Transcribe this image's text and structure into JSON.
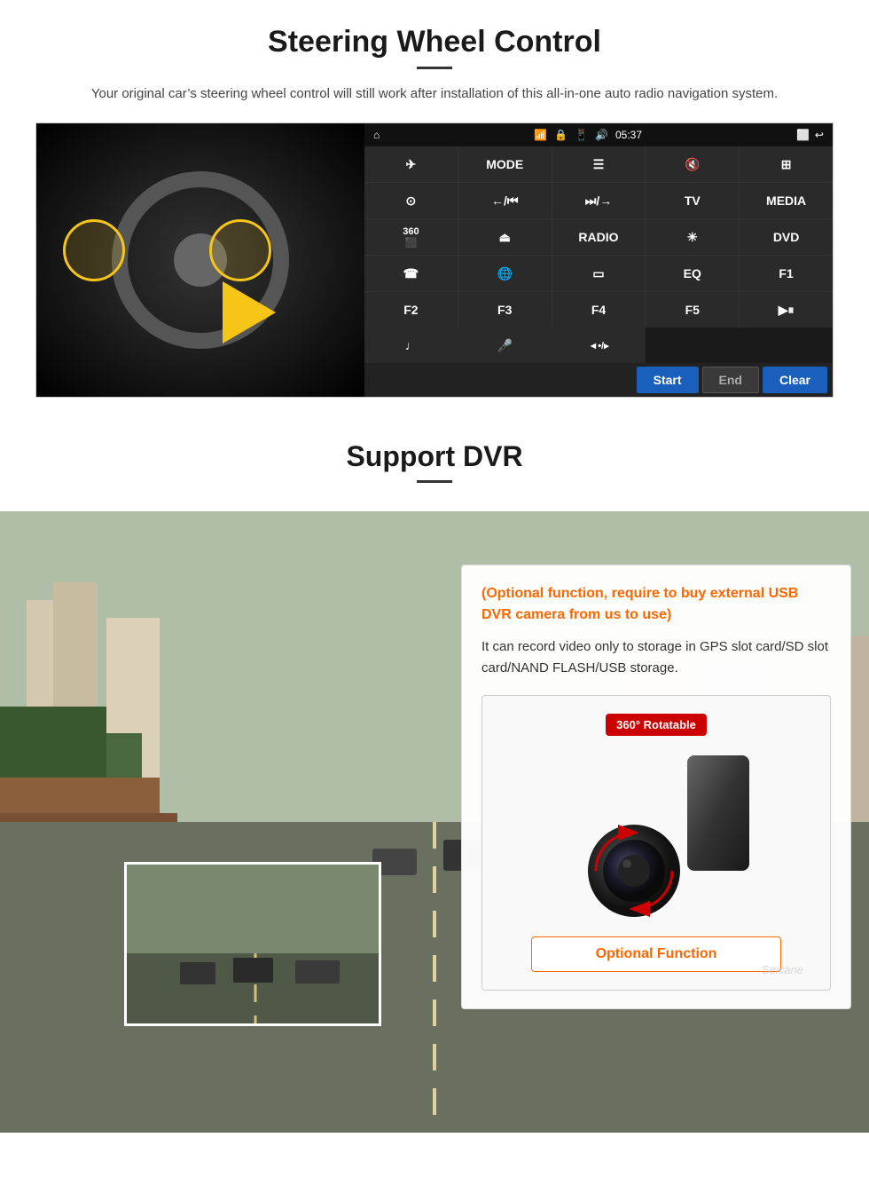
{
  "steering": {
    "title": "Steering Wheel Control",
    "description": "Your original car’s steering wheel control will still work after installation of this all-in-one auto radio navigation system.",
    "statusBar": {
      "home": "⌂",
      "wifi": "▾▴",
      "time": "05:37",
      "back": "↩"
    },
    "buttons": [
      {
        "label": "➡",
        "id": "nav"
      },
      {
        "label": "MODE",
        "id": "mode"
      },
      {
        "label": "≡",
        "id": "menu"
      },
      {
        "label": "◄◄►",
        "id": "mute-vol"
      },
      {
        "label": "⋯",
        "id": "dots"
      },
      {
        "label": "☉",
        "id": "settings"
      },
      {
        "label": "←⁄⏮",
        "id": "prev"
      },
      {
        "label": "⏭⁄→",
        "id": "next"
      },
      {
        "label": "TV",
        "id": "tv"
      },
      {
        "label": "MEDIA",
        "id": "media"
      },
      {
        "label": "360□",
        "id": "360"
      },
      {
        "label": "⏏",
        "id": "eject"
      },
      {
        "label": "RADIO",
        "id": "radio"
      },
      {
        "label": "☀",
        "id": "brightness"
      },
      {
        "label": "DVD",
        "id": "dvd"
      },
      {
        "label": "☎",
        "id": "phone"
      },
      {
        "label": "ⓔ",
        "id": "browser"
      },
      {
        "label": "══",
        "id": "mirror"
      },
      {
        "label": "EQ",
        "id": "eq"
      },
      {
        "label": "F1",
        "id": "f1"
      },
      {
        "label": "F2",
        "id": "f2"
      },
      {
        "label": "F3",
        "id": "f3"
      },
      {
        "label": "F4",
        "id": "f4"
      },
      {
        "label": "F5",
        "id": "f5"
      },
      {
        "label": "►⏸",
        "id": "play-pause"
      },
      {
        "label": "♫",
        "id": "music"
      },
      {
        "label": "🎤",
        "id": "mic"
      },
      {
        "label": "◄•⁄⏵",
        "id": "vol-dir"
      }
    ],
    "bottomBar": {
      "start": "Start",
      "end": "End",
      "clear": "Clear"
    }
  },
  "dvr": {
    "title": "Support DVR",
    "optionalText": "(Optional function, require to buy external USB DVR camera from us to use)",
    "descText": "It can record video only to storage in GPS slot card/SD slot card/NAND FLASH/USB storage.",
    "badge": "360° Rotatable",
    "watermark": "Seicane",
    "optionalFunctionBtn": "Optional Function"
  }
}
